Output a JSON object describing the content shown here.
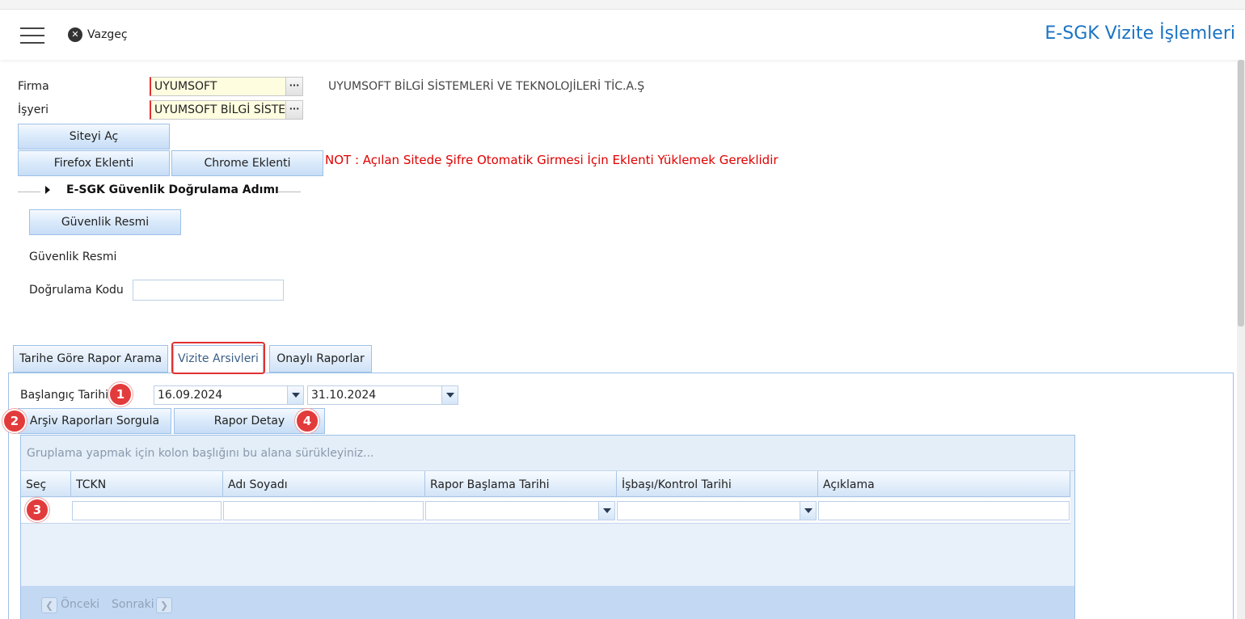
{
  "header": {
    "cancel_label": "Vazgeç",
    "title": "E-SGK Vizite İşlemleri"
  },
  "form": {
    "firma_label": "Firma",
    "firma_value": "UYUMSOFT",
    "firma_description": "UYUMSOFT BİLGİ SİSTEMLERİ VE TEKNOLOJİLERİ TİC.A.Ş",
    "isyeri_label": "İşyeri",
    "isyeri_value": "UYUMSOFT BİLGİ SİSTEMLERİ",
    "lookup_glyph": "···"
  },
  "buttons": {
    "site_open": "Siteyi Aç",
    "firefox": "Firefox Eklenti",
    "chrome": "Chrome Eklenti"
  },
  "note": "NOT : Açılan Sitede Şifre Otomatik Girmesi İçin Eklenti Yüklemek Gereklidir",
  "security": {
    "section_title": "E-SGK Güvenlik Doğrulama Adımı",
    "image_button": "Güvenlik Resmi",
    "image_label": "Güvenlik Resmi",
    "code_label": "Doğrulama Kodu",
    "code_value": ""
  },
  "tabs": [
    {
      "label": "Tarihe Göre Rapor Arama",
      "active": false
    },
    {
      "label": "Vizite Arsivleri",
      "active": true
    },
    {
      "label": "Onaylı Raporlar",
      "active": false
    }
  ],
  "archive": {
    "start_label": "Başlangıç Tarihi",
    "start_date": "16.09.2024",
    "end_date": "31.10.2024",
    "query_button": "Arşiv Raporları Sorgula",
    "detail_button": "Rapor Detay"
  },
  "badges": [
    "1",
    "2",
    "3",
    "4"
  ],
  "grid": {
    "group_hint": "Gruplama yapmak için kolon başlığını bu alana sürükleyiniz...",
    "columns": [
      "Seç",
      "TCKN",
      "Adı Soyadı",
      "Rapor Başlama Tarihi",
      "İşbaşı/Kontrol Tarihi",
      "Açıklama"
    ],
    "pager_prev": "Önceki",
    "pager_next": "Sonraki"
  },
  "colors": {
    "accent_blue": "#1a73c4",
    "required_red": "#e03030",
    "note_red": "#e00000"
  }
}
